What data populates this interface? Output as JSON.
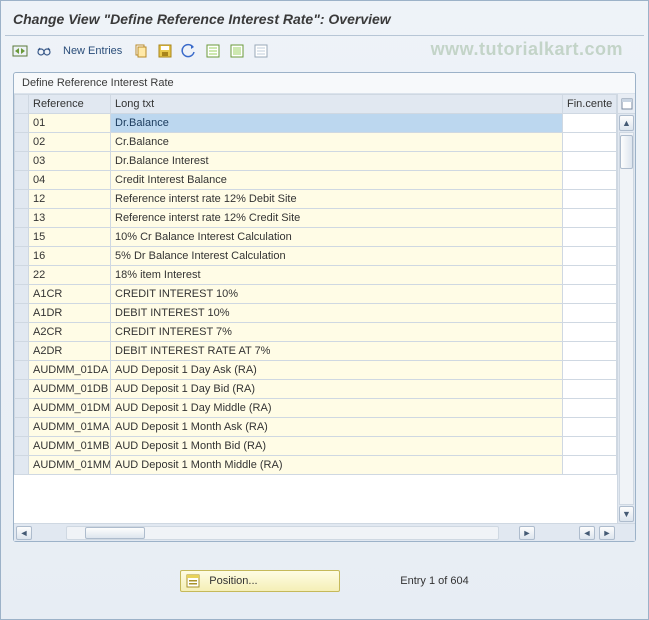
{
  "title": "Change View \"Define Reference Interest Rate\": Overview",
  "watermark": "www.tutorialkart.com",
  "toolbar": {
    "new_entries": "New Entries"
  },
  "panel": {
    "caption": "Define Reference Interest Rate",
    "columns": {
      "reference": "Reference",
      "long_txt": "Long txt",
      "fin_center": "Fin.cente"
    }
  },
  "rows": [
    {
      "ref": "01",
      "long": "Dr.Balance"
    },
    {
      "ref": "02",
      "long": "Cr.Balance"
    },
    {
      "ref": "03",
      "long": "Dr.Balance Interest"
    },
    {
      "ref": "04",
      "long": "Credit Interest Balance"
    },
    {
      "ref": "12",
      "long": "Reference interst rate 12% Debit Site"
    },
    {
      "ref": "13",
      "long": "Reference interst rate 12% Credit Site"
    },
    {
      "ref": "15",
      "long": "10% Cr Balance Interest Calculation"
    },
    {
      "ref": "16",
      "long": "5% Dr Balance Interest Calculation"
    },
    {
      "ref": "22",
      "long": "18% item Interest"
    },
    {
      "ref": "A1CR",
      "long": "CREDIT INTEREST 10%"
    },
    {
      "ref": "A1DR",
      "long": "DEBIT INTEREST 10%"
    },
    {
      "ref": "A2CR",
      "long": "CREDIT INTEREST 7%"
    },
    {
      "ref": "A2DR",
      "long": "DEBIT INTEREST RATE AT 7%"
    },
    {
      "ref": "AUDMM_01DA",
      "long": "AUD Deposit 1 Day Ask (RA)"
    },
    {
      "ref": "AUDMM_01DB",
      "long": "AUD Deposit 1 Day Bid (RA)"
    },
    {
      "ref": "AUDMM_01DM",
      "long": "AUD Deposit 1 Day Middle (RA)"
    },
    {
      "ref": "AUDMM_01MA",
      "long": "AUD Deposit 1 Month Ask (RA)"
    },
    {
      "ref": "AUDMM_01MB",
      "long": "AUD Deposit 1 Month Bid (RA)"
    },
    {
      "ref": "AUDMM_01MM",
      "long": "AUD Deposit 1 Month Middle (RA)"
    }
  ],
  "footer": {
    "position_label": "Position...",
    "entry_text": "Entry 1 of 604"
  },
  "icons": {
    "toggle": "toggle-icon",
    "glasses": "display-icon",
    "copy": "copy-icon",
    "save": "save-icon",
    "undo": "undo-icon",
    "select_all": "select-all-icon",
    "deselect": "deselect-icon",
    "form": "form-icon",
    "config": "config-icon",
    "table": "table-icon"
  }
}
